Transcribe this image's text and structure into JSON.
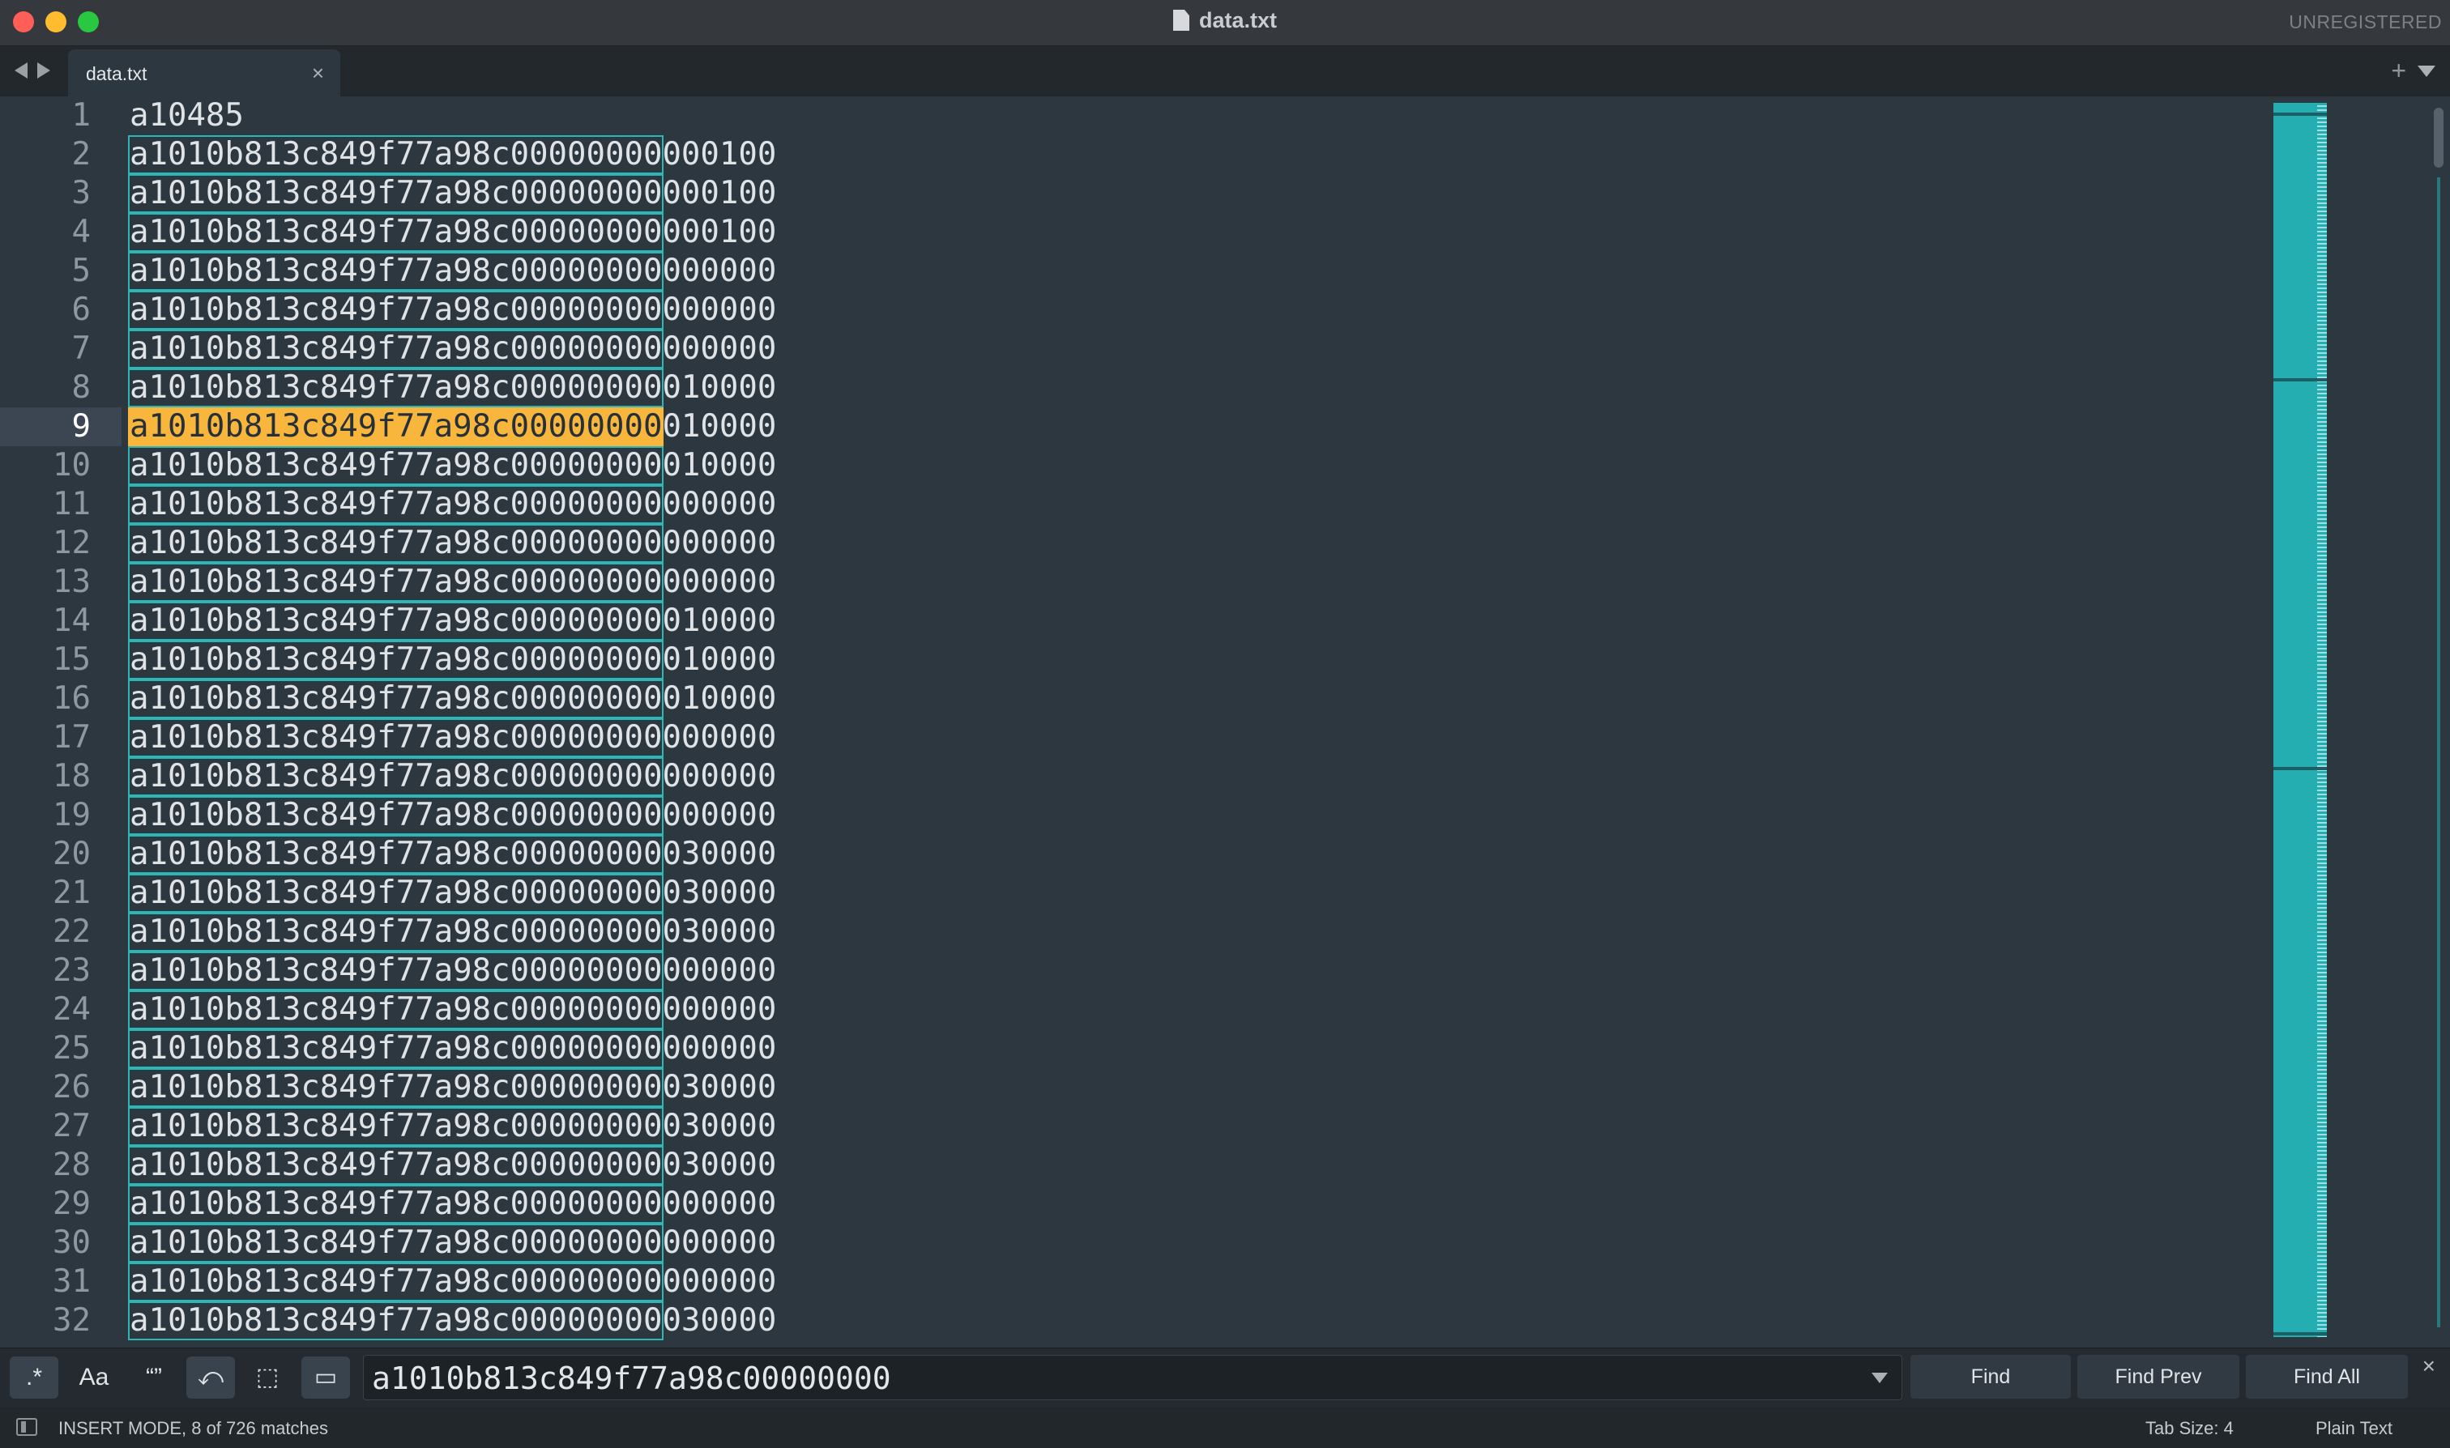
{
  "window": {
    "title": "data.txt",
    "unregistered": "UNREGISTERED"
  },
  "tabs": [
    {
      "label": "data.txt",
      "close": "×"
    }
  ],
  "tabbar": {
    "new_tab": "+"
  },
  "editor": {
    "current_line": 9,
    "match_prefix": "a1010b813c849f77a98c00000000",
    "lines": [
      {
        "n": "1",
        "pre": "a10485",
        "suf": ""
      },
      {
        "n": "2",
        "pre": "",
        "suf": "000100"
      },
      {
        "n": "3",
        "pre": "",
        "suf": "000100"
      },
      {
        "n": "4",
        "pre": "",
        "suf": "000100"
      },
      {
        "n": "5",
        "pre": "",
        "suf": "000000"
      },
      {
        "n": "6",
        "pre": "",
        "suf": "000000"
      },
      {
        "n": "7",
        "pre": "",
        "suf": "000000"
      },
      {
        "n": "8",
        "pre": "",
        "suf": "010000"
      },
      {
        "n": "9",
        "pre": "",
        "suf": "010000"
      },
      {
        "n": "10",
        "pre": "",
        "suf": "010000"
      },
      {
        "n": "11",
        "pre": "",
        "suf": "000000"
      },
      {
        "n": "12",
        "pre": "",
        "suf": "000000"
      },
      {
        "n": "13",
        "pre": "",
        "suf": "000000"
      },
      {
        "n": "14",
        "pre": "",
        "suf": "010000"
      },
      {
        "n": "15",
        "pre": "",
        "suf": "010000"
      },
      {
        "n": "16",
        "pre": "",
        "suf": "010000"
      },
      {
        "n": "17",
        "pre": "",
        "suf": "000000"
      },
      {
        "n": "18",
        "pre": "",
        "suf": "000000"
      },
      {
        "n": "19",
        "pre": "",
        "suf": "000000"
      },
      {
        "n": "20",
        "pre": "",
        "suf": "030000"
      },
      {
        "n": "21",
        "pre": "",
        "suf": "030000"
      },
      {
        "n": "22",
        "pre": "",
        "suf": "030000"
      },
      {
        "n": "23",
        "pre": "",
        "suf": "000000"
      },
      {
        "n": "24",
        "pre": "",
        "suf": "000000"
      },
      {
        "n": "25",
        "pre": "",
        "suf": "000000"
      },
      {
        "n": "26",
        "pre": "",
        "suf": "030000"
      },
      {
        "n": "27",
        "pre": "",
        "suf": "030000"
      },
      {
        "n": "28",
        "pre": "",
        "suf": "030000"
      },
      {
        "n": "29",
        "pre": "",
        "suf": "000000"
      },
      {
        "n": "30",
        "pre": "",
        "suf": "000000"
      },
      {
        "n": "31",
        "pre": "",
        "suf": "000000"
      },
      {
        "n": "32",
        "pre": "",
        "suf": "030000"
      }
    ]
  },
  "find": {
    "options": [
      {
        "name": "regex-toggle",
        "label": ".*",
        "on": true
      },
      {
        "name": "case-sensitive-toggle",
        "label": "Aa",
        "on": false
      },
      {
        "name": "whole-word-toggle",
        "label": "“”",
        "on": false
      },
      {
        "name": "wrap-toggle",
        "label": "⤺",
        "on": true
      },
      {
        "name": "in-selection-toggle",
        "label": "⬚",
        "on": false
      },
      {
        "name": "highlight-matches-toggle",
        "label": "▭",
        "on": true
      }
    ],
    "query": "a1010b813c849f77a98c00000000",
    "find_label": "Find",
    "find_prev_label": "Find Prev",
    "find_all_label": "Find All",
    "close": "×"
  },
  "status": {
    "left": "INSERT MODE, 8 of 726 matches",
    "tab_size": "Tab Size: 4",
    "syntax": "Plain Text"
  },
  "colors": {
    "match_outline": "#2db6b6",
    "active_match": "#f8b63c",
    "background": "#2d3740"
  }
}
